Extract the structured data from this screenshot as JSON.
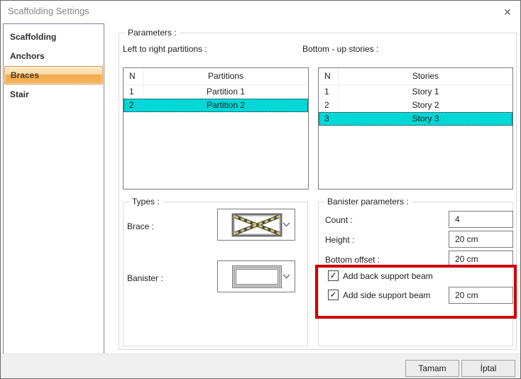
{
  "window": {
    "title": "Scaffolding Settings",
    "close_glyph": "✕"
  },
  "sidebar": {
    "items": [
      {
        "label": "Scaffolding",
        "selected": false
      },
      {
        "label": "Anchors",
        "selected": false
      },
      {
        "label": "Braces",
        "selected": true
      },
      {
        "label": "Stair",
        "selected": false
      }
    ]
  },
  "parameters": {
    "group_label": "Parameters :",
    "partitions_label": "Left to right partitions :",
    "stories_label": "Bottom - up stories :",
    "partitions_table": {
      "columns": [
        "N",
        "Partitions"
      ],
      "rows": [
        {
          "n": "1",
          "value": "Partition 1",
          "selected": false
        },
        {
          "n": "2",
          "value": "Partition 2",
          "selected": true
        }
      ]
    },
    "stories_table": {
      "columns": [
        "N",
        "Stories"
      ],
      "rows": [
        {
          "n": "1",
          "value": "Story 1",
          "selected": false
        },
        {
          "n": "2",
          "value": "Story 2",
          "selected": false
        },
        {
          "n": "3",
          "value": "Story 3",
          "selected": true
        }
      ]
    }
  },
  "types": {
    "group_label": "Types :",
    "brace_label": "Brace :",
    "banister_label": "Banister :",
    "brace_icon": "cross-braced-panel",
    "banister_icon": "empty-rail-panel"
  },
  "banister_parameters": {
    "group_label": "Banister parameters :",
    "count_label": "Count :",
    "count_value": "4",
    "height_label": "Height :",
    "height_value": "20 cm",
    "bottom_offset_label": "Bottom offset :",
    "bottom_offset_value": "20 cm",
    "back_beam_label": "Add back support beam",
    "back_beam_checked": true,
    "side_beam_label": "Add side support beam",
    "side_beam_checked": true,
    "side_beam_value": "20 cm"
  },
  "icons": {
    "check": "✓"
  },
  "footer": {
    "ok_label": "Tamam",
    "cancel_label": "İptal"
  },
  "colors": {
    "selection_cyan": "#00d7d7",
    "sidebar_selected_orange": "#f6b45d",
    "sidebar_selected_border": "#dd9140",
    "annotation_red": "#cb0000",
    "brace_cross_yellow": "#d6c44e",
    "footer_gray": "#f0f0f0"
  }
}
